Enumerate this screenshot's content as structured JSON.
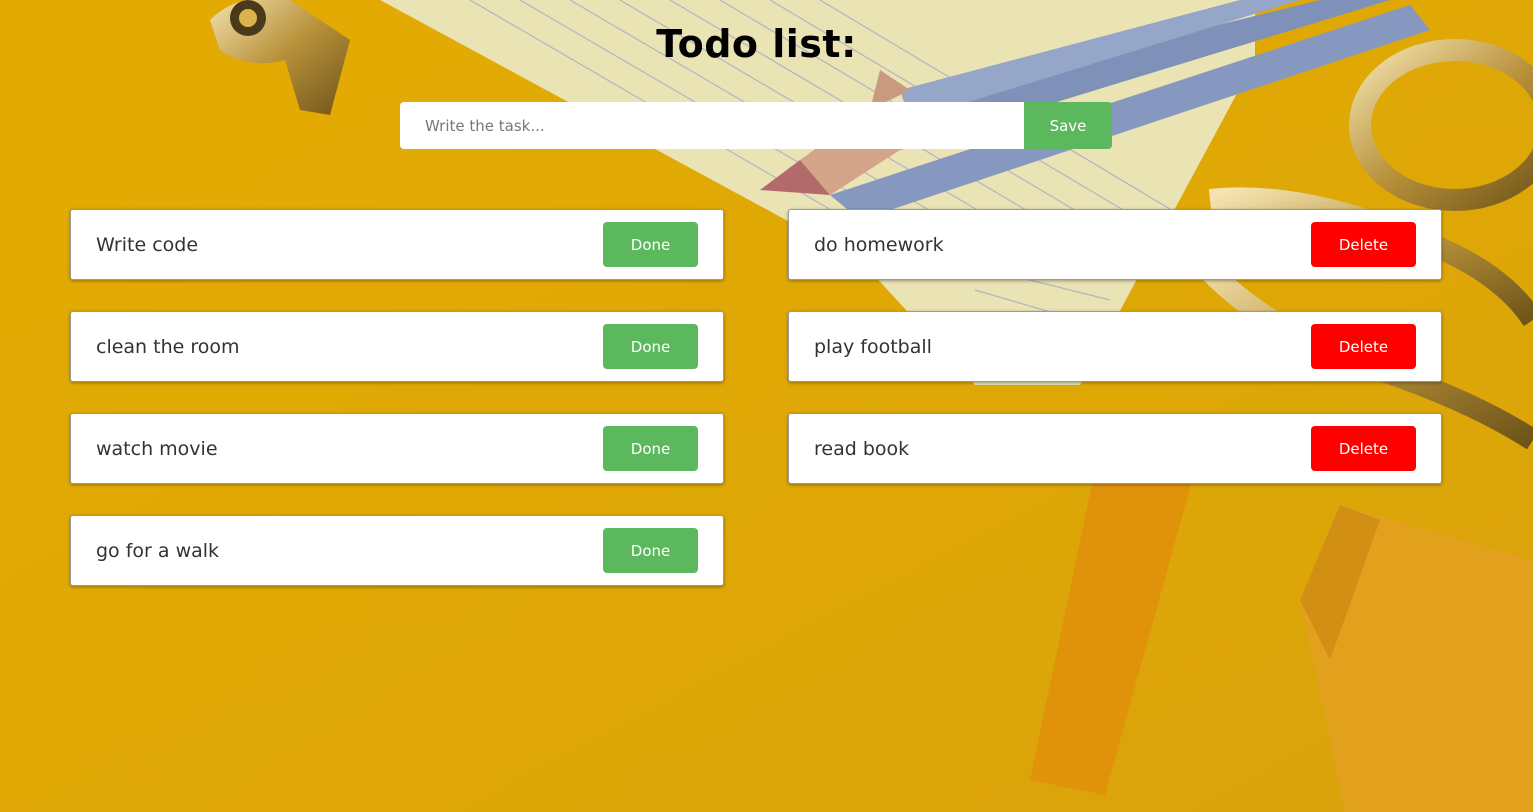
{
  "header": {
    "title": "Todo list:"
  },
  "form": {
    "placeholder": "Write the task...",
    "save_label": "Save"
  },
  "todo": [
    {
      "text": "Write code",
      "action": "Done"
    },
    {
      "text": "clean the room",
      "action": "Done"
    },
    {
      "text": "watch movie",
      "action": "Done"
    },
    {
      "text": "go for a walk",
      "action": "Done"
    }
  ],
  "done": [
    {
      "text": "do homework",
      "action": "Delete"
    },
    {
      "text": "play football",
      "action": "Delete"
    },
    {
      "text": "read book",
      "action": "Delete"
    }
  ],
  "colors": {
    "background": "#e0a904",
    "done_button": "#5cb85c",
    "delete_button": "#ff0000"
  }
}
